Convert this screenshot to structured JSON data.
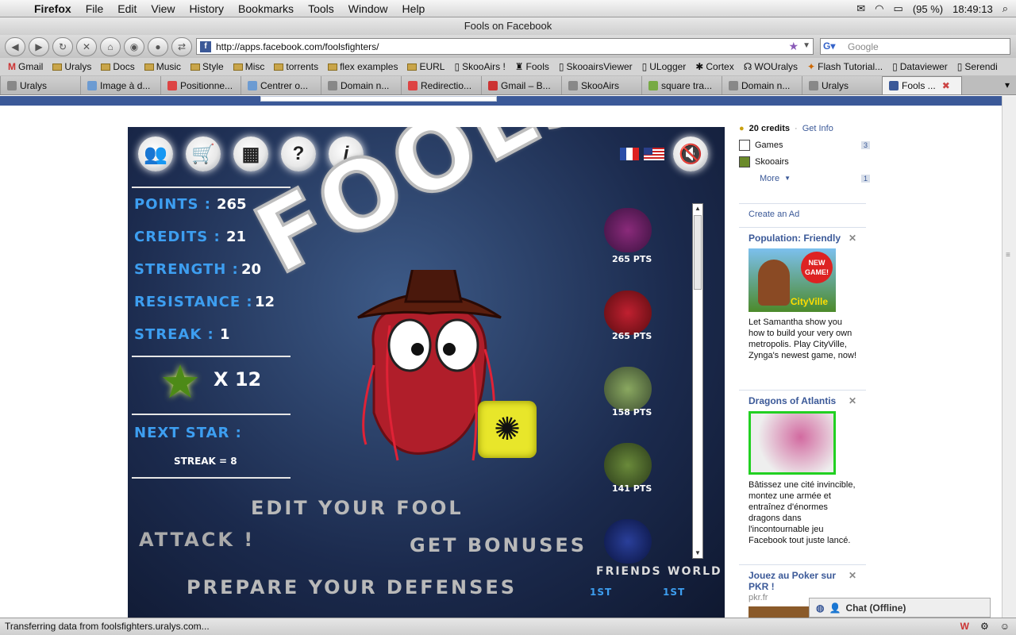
{
  "menubar": {
    "app": "Firefox",
    "items": [
      "File",
      "Edit",
      "View",
      "History",
      "Bookmarks",
      "Tools",
      "Window",
      "Help"
    ],
    "battery": "(95 %)",
    "clock": "18:49:13"
  },
  "window": {
    "title": "Fools on Facebook"
  },
  "nav": {
    "url": "http://apps.facebook.com/foolsfighters/",
    "search_placeholder": "Google"
  },
  "bookmarks": [
    "Gmail",
    "Uralys",
    "Docs",
    "Music",
    "Style",
    "Misc",
    "torrents",
    "flex examples",
    "EURL",
    "SkooAirs !",
    "Fools",
    "SkooairsViewer",
    "ULogger",
    "Cortex",
    "WOUralys",
    "Flash Tutorial...",
    "Dataviewer",
    "Serendi"
  ],
  "tabs": [
    "Uralys",
    "Image à d...",
    "Positionne...",
    "Centrer o...",
    "Domain n...",
    "Redirectio...",
    "Gmail – B...",
    "SkooAirs",
    "square tra...",
    "Domain n...",
    "Uralys",
    "Fools ..."
  ],
  "game": {
    "title": "FOOLS!",
    "stats": [
      {
        "label": "POINTS :",
        "value": "265"
      },
      {
        "label": "CREDITS :",
        "value": "21"
      },
      {
        "label": "STRENGTH :",
        "value": "20"
      },
      {
        "label": "RESISTANCE :",
        "value": "12"
      },
      {
        "label": "STREAK :",
        "value": "1"
      }
    ],
    "stars": "X 12",
    "next_star": "NEXT STAR :",
    "streak_goal": "STREAK = 8",
    "menu": {
      "edit": "EDIT YOUR FOOL",
      "attack": "ATTACK !",
      "bonuses": "GET BONUSES",
      "defenses": "PREPARE YOUR DEFENSES"
    },
    "ranking": [
      "265 PTS",
      "265 PTS",
      "158 PTS",
      "141 PTS"
    ],
    "tabs": {
      "friends": "FRIENDS",
      "world": "WORLD",
      "friends_rank": "1ST",
      "world_rank": "1ST"
    }
  },
  "sidebar": {
    "credits": "20 credits",
    "get_info": "Get Info",
    "games": "Games",
    "games_count": "3",
    "skooairs": "Skooairs",
    "more": "More",
    "more_count": "1",
    "create_ad": "Create an Ad"
  },
  "ads": [
    {
      "title": "Population: Friendly",
      "text": "Let Samantha show you how to build your very own metropolis. Play CityVille, Zynga's newest game, now!",
      "img_text": "NEW GAME!",
      "img_brand": "CityVille"
    },
    {
      "title": "Dragons of Atlantis",
      "text": "Bâtissez une cité invincible, montez une armée et entraînez d'énormes dragons dans l'incontournable jeu Facebook tout juste lancé."
    },
    {
      "title": "Jouez au Poker sur PKR !",
      "domain": "pkr.fr"
    }
  ],
  "chat": "Chat (Offline)",
  "status": "Transferring data from foolsfighters.uralys.com..."
}
